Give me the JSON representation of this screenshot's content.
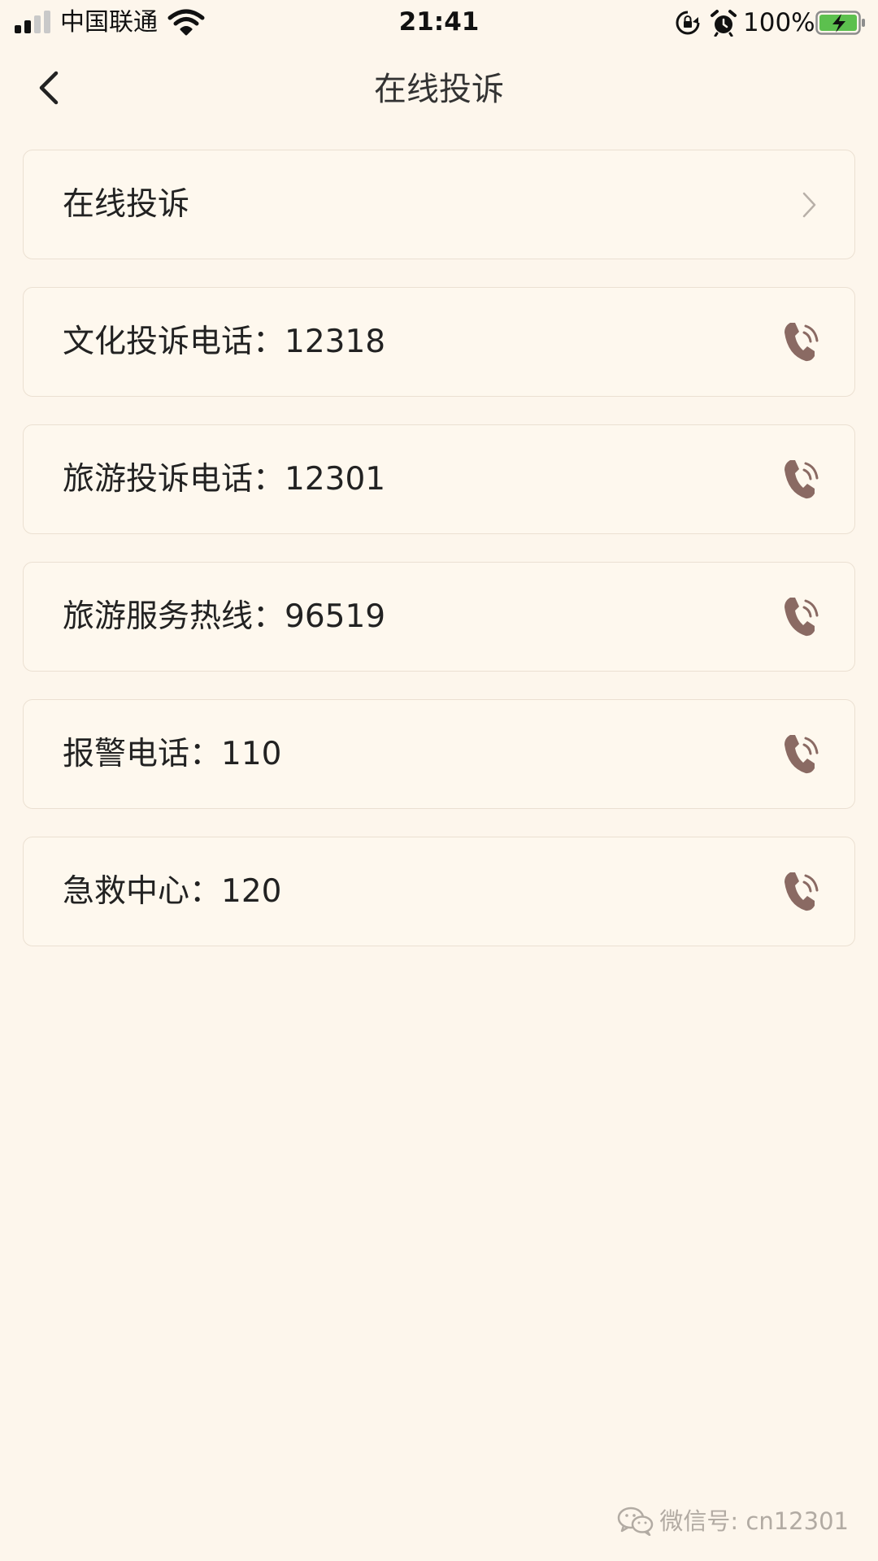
{
  "status_bar": {
    "carrier": "中国联通",
    "time": "21:41",
    "battery_percent": "100%",
    "signal_bars_filled": 2,
    "signal_bars_total": 4,
    "battery_level": 1.0,
    "battery_charging": true,
    "icons": [
      "signal-icon",
      "wifi-icon",
      "rotation-lock-icon",
      "alarm-icon",
      "battery-icon"
    ]
  },
  "nav": {
    "title": "在线投诉",
    "back_icon": "back-chevron-icon"
  },
  "items": [
    {
      "label": "在线投诉",
      "icon": "chevron-right-icon"
    },
    {
      "label": "文化投诉电话：12318",
      "icon": "phone-icon"
    },
    {
      "label": "旅游投诉电话：12301",
      "icon": "phone-icon"
    },
    {
      "label": "旅游服务热线：96519",
      "icon": "phone-icon"
    },
    {
      "label": "报警电话：110",
      "icon": "phone-icon"
    },
    {
      "label": "急救中心：120",
      "icon": "phone-icon"
    }
  ],
  "watermark": {
    "text": "微信号: cn12301",
    "icon": "wechat-logo-icon"
  },
  "colors": {
    "background": "#fdf6ec",
    "card_background": "#fef8ee",
    "card_border": "#ebe0d2",
    "phone_icon": "#8a6a63",
    "chevron": "#b8b0a8",
    "battery_fill": "#5cc04e"
  }
}
